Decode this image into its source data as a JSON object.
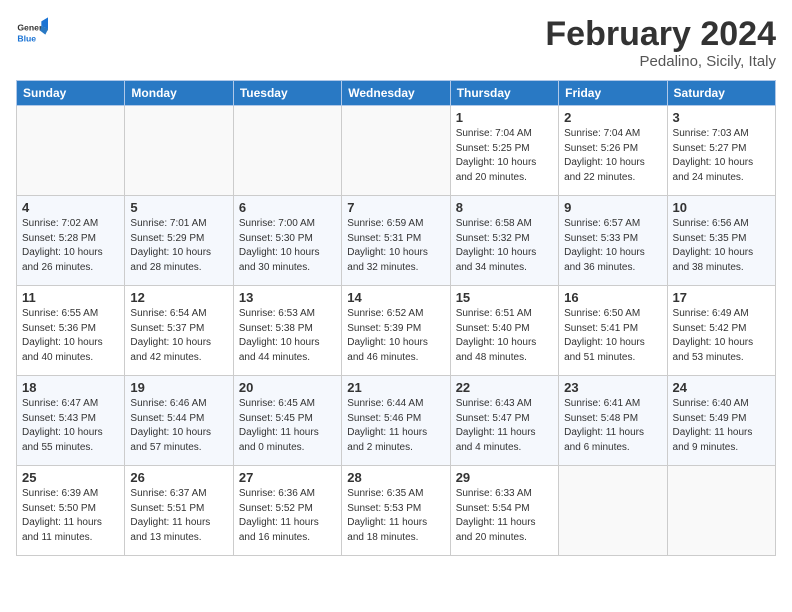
{
  "header": {
    "logo_general": "General",
    "logo_blue": "Blue",
    "month_title": "February 2024",
    "location": "Pedalino, Sicily, Italy"
  },
  "days_of_week": [
    "Sunday",
    "Monday",
    "Tuesday",
    "Wednesday",
    "Thursday",
    "Friday",
    "Saturday"
  ],
  "weeks": [
    [
      {
        "day": "",
        "info": ""
      },
      {
        "day": "",
        "info": ""
      },
      {
        "day": "",
        "info": ""
      },
      {
        "day": "",
        "info": ""
      },
      {
        "day": "1",
        "info": "Sunrise: 7:04 AM\nSunset: 5:25 PM\nDaylight: 10 hours\nand 20 minutes."
      },
      {
        "day": "2",
        "info": "Sunrise: 7:04 AM\nSunset: 5:26 PM\nDaylight: 10 hours\nand 22 minutes."
      },
      {
        "day": "3",
        "info": "Sunrise: 7:03 AM\nSunset: 5:27 PM\nDaylight: 10 hours\nand 24 minutes."
      }
    ],
    [
      {
        "day": "4",
        "info": "Sunrise: 7:02 AM\nSunset: 5:28 PM\nDaylight: 10 hours\nand 26 minutes."
      },
      {
        "day": "5",
        "info": "Sunrise: 7:01 AM\nSunset: 5:29 PM\nDaylight: 10 hours\nand 28 minutes."
      },
      {
        "day": "6",
        "info": "Sunrise: 7:00 AM\nSunset: 5:30 PM\nDaylight: 10 hours\nand 30 minutes."
      },
      {
        "day": "7",
        "info": "Sunrise: 6:59 AM\nSunset: 5:31 PM\nDaylight: 10 hours\nand 32 minutes."
      },
      {
        "day": "8",
        "info": "Sunrise: 6:58 AM\nSunset: 5:32 PM\nDaylight: 10 hours\nand 34 minutes."
      },
      {
        "day": "9",
        "info": "Sunrise: 6:57 AM\nSunset: 5:33 PM\nDaylight: 10 hours\nand 36 minutes."
      },
      {
        "day": "10",
        "info": "Sunrise: 6:56 AM\nSunset: 5:35 PM\nDaylight: 10 hours\nand 38 minutes."
      }
    ],
    [
      {
        "day": "11",
        "info": "Sunrise: 6:55 AM\nSunset: 5:36 PM\nDaylight: 10 hours\nand 40 minutes."
      },
      {
        "day": "12",
        "info": "Sunrise: 6:54 AM\nSunset: 5:37 PM\nDaylight: 10 hours\nand 42 minutes."
      },
      {
        "day": "13",
        "info": "Sunrise: 6:53 AM\nSunset: 5:38 PM\nDaylight: 10 hours\nand 44 minutes."
      },
      {
        "day": "14",
        "info": "Sunrise: 6:52 AM\nSunset: 5:39 PM\nDaylight: 10 hours\nand 46 minutes."
      },
      {
        "day": "15",
        "info": "Sunrise: 6:51 AM\nSunset: 5:40 PM\nDaylight: 10 hours\nand 48 minutes."
      },
      {
        "day": "16",
        "info": "Sunrise: 6:50 AM\nSunset: 5:41 PM\nDaylight: 10 hours\nand 51 minutes."
      },
      {
        "day": "17",
        "info": "Sunrise: 6:49 AM\nSunset: 5:42 PM\nDaylight: 10 hours\nand 53 minutes."
      }
    ],
    [
      {
        "day": "18",
        "info": "Sunrise: 6:47 AM\nSunset: 5:43 PM\nDaylight: 10 hours\nand 55 minutes."
      },
      {
        "day": "19",
        "info": "Sunrise: 6:46 AM\nSunset: 5:44 PM\nDaylight: 10 hours\nand 57 minutes."
      },
      {
        "day": "20",
        "info": "Sunrise: 6:45 AM\nSunset: 5:45 PM\nDaylight: 11 hours\nand 0 minutes."
      },
      {
        "day": "21",
        "info": "Sunrise: 6:44 AM\nSunset: 5:46 PM\nDaylight: 11 hours\nand 2 minutes."
      },
      {
        "day": "22",
        "info": "Sunrise: 6:43 AM\nSunset: 5:47 PM\nDaylight: 11 hours\nand 4 minutes."
      },
      {
        "day": "23",
        "info": "Sunrise: 6:41 AM\nSunset: 5:48 PM\nDaylight: 11 hours\nand 6 minutes."
      },
      {
        "day": "24",
        "info": "Sunrise: 6:40 AM\nSunset: 5:49 PM\nDaylight: 11 hours\nand 9 minutes."
      }
    ],
    [
      {
        "day": "25",
        "info": "Sunrise: 6:39 AM\nSunset: 5:50 PM\nDaylight: 11 hours\nand 11 minutes."
      },
      {
        "day": "26",
        "info": "Sunrise: 6:37 AM\nSunset: 5:51 PM\nDaylight: 11 hours\nand 13 minutes."
      },
      {
        "day": "27",
        "info": "Sunrise: 6:36 AM\nSunset: 5:52 PM\nDaylight: 11 hours\nand 16 minutes."
      },
      {
        "day": "28",
        "info": "Sunrise: 6:35 AM\nSunset: 5:53 PM\nDaylight: 11 hours\nand 18 minutes."
      },
      {
        "day": "29",
        "info": "Sunrise: 6:33 AM\nSunset: 5:54 PM\nDaylight: 11 hours\nand 20 minutes."
      },
      {
        "day": "",
        "info": ""
      },
      {
        "day": "",
        "info": ""
      }
    ]
  ]
}
